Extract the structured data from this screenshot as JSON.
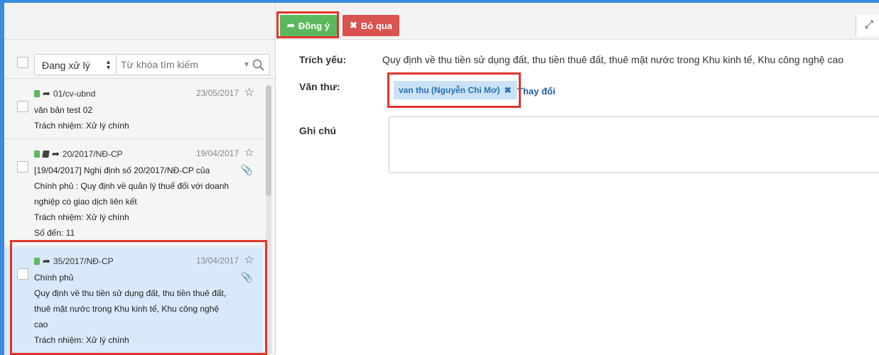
{
  "filter": {
    "status_value": "Đang xử lý",
    "search_placeholder": "Từ khóa tìm kiếm"
  },
  "toolbar": {
    "approve_label": "Đồng ý",
    "skip_label": "Bỏ qua"
  },
  "documents": [
    {
      "code": "01/cv-ubnd",
      "date": "23/05/2017",
      "lines": [
        "văn bản test 02",
        "Trách nhiệm: Xử lý chính"
      ]
    },
    {
      "code": "20/2017/NĐ-CP",
      "date": "19/04/2017",
      "lines": [
        "[19/04/2017] Nghị định số 20/2017/NĐ-CP của",
        "Chính phủ : Quy định về quản lý thuế đối với doanh",
        "nghiệp có giao dịch liên kết",
        "Trách nhiệm: Xử lý chính",
        "Số đến: 11"
      ]
    },
    {
      "code": "35/2017/NĐ-CP",
      "date": "13/04/2017",
      "lines": [
        "Chính phủ",
        "Quy định về thu tiền sử dụng đất, thu tiền thuê đất,",
        "thuê mặt nước trong Khu kinh tế, Khu công nghệ",
        "cao",
        "Trách nhiệm: Xử lý chính"
      ]
    }
  ],
  "detail": {
    "summary_label": "Trích yếu:",
    "summary_value": "Quy định về thu tiền sử dụng đất, thu tiền thuê đất, thuê mặt nước trong Khu kinh tế, Khu công nghệ cao",
    "clerk_label": "Văn thư:",
    "clerk_tag": "van thu (Nguyễn Chi Mơ)",
    "change_link": "Thay đổi",
    "note_label": "Ghi chú"
  },
  "colors": {
    "accent_frame": "#3a8be0",
    "approve": "#5cb85c",
    "skip": "#d9534f",
    "highlight_box": "#e0362c",
    "selected_row": "#d9e9fa"
  }
}
